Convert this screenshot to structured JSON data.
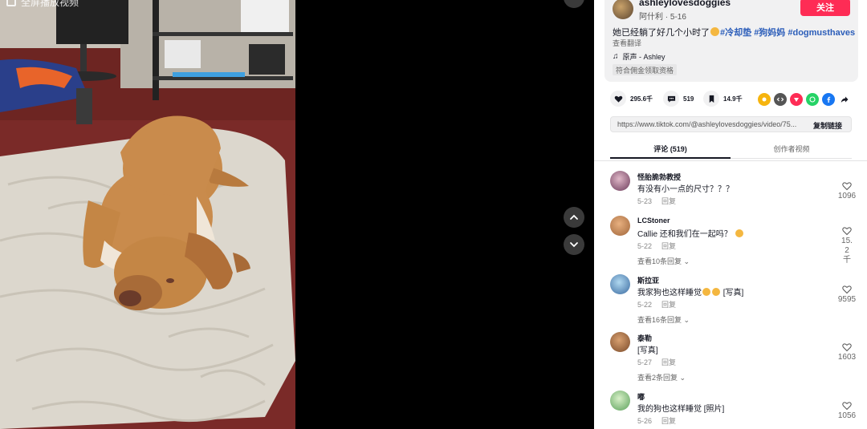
{
  "video": {
    "overlay_text": "全屏播放视频"
  },
  "author": {
    "name": "ashleylovesdoggies",
    "sub": "阿什利 · 5-16",
    "follow_label": "关注"
  },
  "caption": {
    "text": "她已经躺了好几个小时了",
    "tags": [
      "#冷却垫",
      "#狗妈妈",
      "#dogmusthaves"
    ],
    "translate_label": "查看翻译",
    "music": "原声 - Ashley",
    "eligible": "符合佣金领取资格"
  },
  "stats": {
    "likes": "295.6千",
    "comments": "519",
    "saves": "14.9千"
  },
  "share_icons": [
    {
      "name": "embed-share-icon",
      "color": "#f6b40e"
    },
    {
      "name": "code-embed-icon",
      "color": "#555555"
    },
    {
      "name": "send-to-friends-icon",
      "color": "#fe2c55"
    },
    {
      "name": "whatsapp-icon",
      "color": "#25d366"
    },
    {
      "name": "facebook-icon",
      "color": "#1877f2"
    },
    {
      "name": "share-arrow-icon",
      "color": "#161823"
    }
  ],
  "link": {
    "url": "https://www.tiktok.com/@ashleylovesdoggies/video/75...",
    "copy_label": "复制链接"
  },
  "tabs": {
    "comments": "评论 (519)",
    "creator_videos": "创作者视频"
  },
  "comments": [
    {
      "name": "怪胎脆勃教授",
      "text": "有没有小一点的尺寸？？？",
      "date": "5-23",
      "reply": "回复",
      "likes": "1096",
      "more": "",
      "avatar": "#6b3a5a"
    },
    {
      "name": "LCStoner",
      "text": "Callie 还和我们在一起吗？",
      "emoji": true,
      "date": "5-22",
      "reply": "回复",
      "likes": "15.2千",
      "more": "查看10条回复",
      "avatar": "#a0663a"
    },
    {
      "name": "斯拉亚",
      "text": "我家狗也这样睡觉",
      "emoji2": "[写真]",
      "date": "5-22",
      "reply": "回复",
      "likes": "9595",
      "more": "查看16条回复",
      "avatar": "#3a6aa0"
    },
    {
      "name": "泰勒",
      "text": "[写真]",
      "date": "5-27",
      "reply": "回复",
      "likes": "1603",
      "more": "查看2条回复",
      "avatar": "#7a4a2a"
    },
    {
      "name": "嘟",
      "text": "我的狗也这样睡觉 [照片]",
      "date": "5-26",
      "reply": "回复",
      "likes": "1056",
      "more": "",
      "avatar": "#5aa05a"
    }
  ],
  "colors": {
    "accent": "#fe2c55",
    "tag": "#2b5db9"
  }
}
